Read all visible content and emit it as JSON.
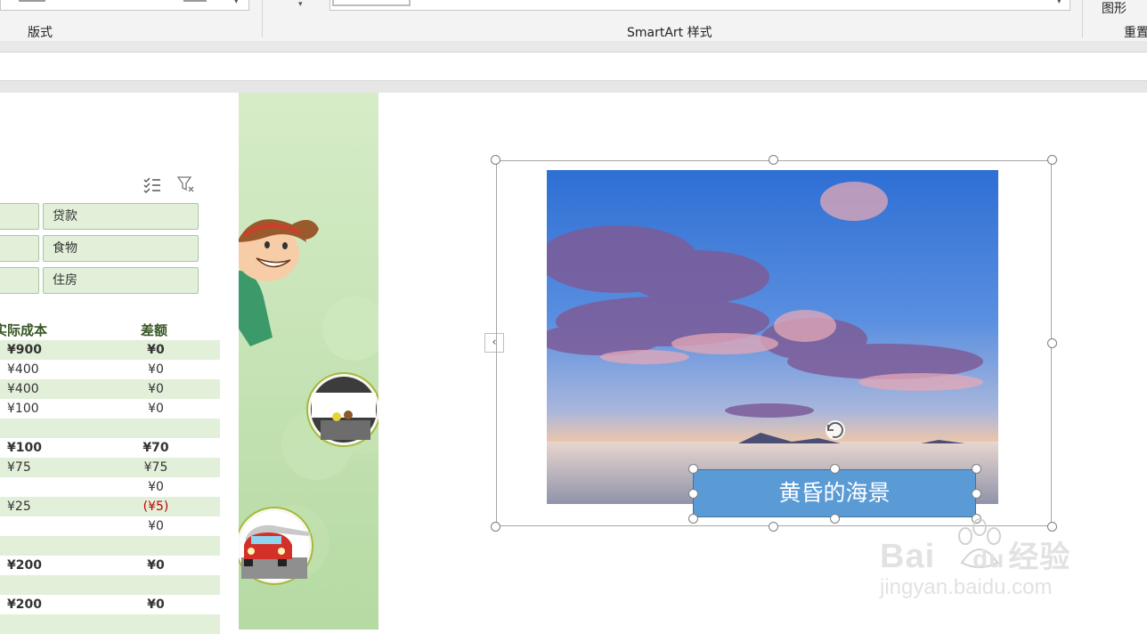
{
  "ribbon": {
    "group_layout": "版式",
    "group_smartart_styles": "SmartArt 样式",
    "group_shape": "图形",
    "group_reset": "重置"
  },
  "slicer": {
    "items": [
      "贷款",
      "食物",
      "住房"
    ]
  },
  "table": {
    "headers": [
      "实际成本",
      "差额"
    ],
    "rows": [
      {
        "actual": "¥900",
        "diff": "¥0",
        "bold": true,
        "shade": true
      },
      {
        "actual": "¥400",
        "diff": "¥0",
        "bold": false,
        "shade": false
      },
      {
        "actual": "¥400",
        "diff": "¥0",
        "bold": false,
        "shade": true
      },
      {
        "actual": "¥100",
        "diff": "¥0",
        "bold": false,
        "shade": false
      },
      {
        "actual": "",
        "diff": "",
        "bold": false,
        "shade": true
      },
      {
        "actual": "¥100",
        "diff": "¥70",
        "bold": true,
        "shade": false
      },
      {
        "actual": "¥75",
        "diff": "¥75",
        "bold": false,
        "shade": true
      },
      {
        "actual": "",
        "diff": "¥0",
        "bold": false,
        "shade": false
      },
      {
        "actual": "¥25",
        "diff": "(¥5)",
        "bold": false,
        "shade": true,
        "negative": true
      },
      {
        "actual": "",
        "diff": "¥0",
        "bold": false,
        "shade": false
      },
      {
        "actual": "",
        "diff": "",
        "bold": false,
        "shade": true
      },
      {
        "actual": "¥200",
        "diff": "¥0",
        "bold": true,
        "shade": false
      },
      {
        "actual": "",
        "diff": "",
        "bold": false,
        "shade": true
      },
      {
        "actual": "¥200",
        "diff": "¥0",
        "bold": true,
        "shade": false
      },
      {
        "actual": "",
        "diff": "",
        "bold": false,
        "shade": true
      }
    ]
  },
  "slide": {
    "caption": "黄昏的海景",
    "collapse_glyph": "‹"
  },
  "watermark": {
    "brand": "Bai",
    "brand_suffix": "du",
    "cn": "经验",
    "url": "jingyan.baidu.com"
  },
  "colors": {
    "caption_fill": "#5b9bd5",
    "table_shade": "#e2efd9",
    "negative": "#c00000"
  }
}
